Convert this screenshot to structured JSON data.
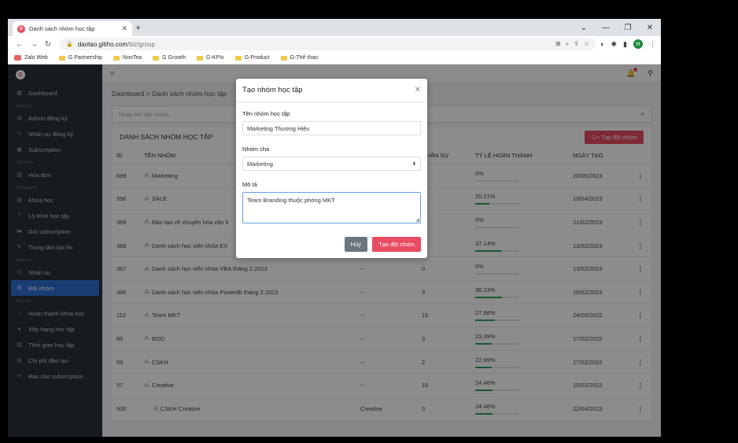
{
  "browser": {
    "tab_title": "Danh sách nhóm học tập",
    "favicon": "G",
    "url_host": "daotao.gitiho.com",
    "url_path": "/biz/group",
    "profile_initial": "H",
    "bookmarks": [
      "Zalo Web",
      "G Partnership",
      "NooTea",
      "G Growth",
      "G-KPIs",
      "G-Product",
      "G-Thể thao"
    ]
  },
  "sidebar": {
    "logo": "G",
    "items": [
      {
        "type": "item",
        "label": "Dashboard",
        "icon": "dashboard-icon",
        "glyph": "▦"
      },
      {
        "type": "group",
        "label": "Đăng ký"
      },
      {
        "type": "item",
        "label": "Admin đăng ký",
        "icon": "register-icon",
        "glyph": "▤"
      },
      {
        "type": "item",
        "label": "Nhân sự đăng ký",
        "icon": "user-register-icon",
        "glyph": "⚇"
      },
      {
        "type": "item",
        "label": "Subscription",
        "icon": "subscription-icon",
        "glyph": "▣"
      },
      {
        "type": "group",
        "label": "Tài chính"
      },
      {
        "type": "item",
        "label": "Hóa đơn",
        "icon": "invoice-icon",
        "glyph": "▥"
      },
      {
        "type": "group",
        "label": "Tài nguyên"
      },
      {
        "type": "item",
        "label": "Khóa học",
        "icon": "course-icon",
        "glyph": "▤"
      },
      {
        "type": "item",
        "label": "Lộ trình học tập",
        "icon": "roadmap-icon",
        "glyph": "⤒"
      },
      {
        "type": "item",
        "label": "Gói subscription",
        "icon": "package-icon",
        "glyph": "⧓"
      },
      {
        "type": "item",
        "label": "Trung tâm bài thi",
        "icon": "exam-icon",
        "glyph": "✎"
      },
      {
        "type": "group",
        "label": "Nhân sự"
      },
      {
        "type": "item",
        "label": "Nhân sự",
        "icon": "staff-icon",
        "glyph": "☷"
      },
      {
        "type": "item",
        "label": "Đội nhóm",
        "icon": "team-icon",
        "glyph": "☰",
        "active": true
      },
      {
        "type": "group",
        "label": "Báo cáo"
      },
      {
        "type": "item",
        "label": "Hoàn thành khóa học",
        "icon": "complete-icon",
        "glyph": "○"
      },
      {
        "type": "item",
        "label": "Xếp hạng học tập",
        "icon": "rank-icon",
        "glyph": "♦"
      },
      {
        "type": "item",
        "label": "Thời gian học tập",
        "icon": "time-icon",
        "glyph": "▥"
      },
      {
        "type": "item",
        "label": "Chi phí đào tạo",
        "icon": "cost-icon",
        "glyph": "◍"
      },
      {
        "type": "item",
        "label": "Báo cáo subscription",
        "icon": "report-icon",
        "glyph": "✂"
      }
    ]
  },
  "main": {
    "breadcrumb": "Dashboard > Danh sách nhóm học tập",
    "search_placeholder": "Nhập tên đội nhóm...",
    "list_title": "DANH SÁCH NHÓM HỌC TẬP",
    "add_button": "Tạo đội nhóm",
    "columns": [
      "ID",
      "TÊN NHÓM",
      "",
      "NHÂN SỰ",
      "TỶ LỆ HOÀN THÀNH",
      "NGÀY TẠO",
      ""
    ],
    "rows": [
      {
        "id": "699",
        "name": "Marketing",
        "parent": "",
        "staff": "",
        "rate": "0%",
        "rate_value": 0,
        "date": "20/05/2023"
      },
      {
        "id": "596",
        "name": "SALE",
        "parent": "",
        "staff": "",
        "rate": "20.21%",
        "rate_value": 20.21,
        "date": "19/04/2023"
      },
      {
        "id": "389",
        "name": "Đào tạo về chuyển hóa văn h",
        "parent": "",
        "staff": "",
        "rate": "0%",
        "rate_value": 0,
        "date": "21/02/2023"
      },
      {
        "id": "388",
        "name": "Danh sách học viên khóa EX",
        "parent": "",
        "staff": "",
        "rate": "37.14%",
        "rate_value": 37.14,
        "date": "13/02/2023"
      },
      {
        "id": "387",
        "name": "Danh sách học viên khóa VBA tháng 2.2023",
        "parent": "--",
        "staff": "0",
        "rate": "0%",
        "rate_value": 0,
        "date": "13/02/2023"
      },
      {
        "id": "386",
        "name": "Danh sách học viên khóa PowerBI tháng 2.2023",
        "parent": "--",
        "staff": "3",
        "rate": "38.23%",
        "rate_value": 38.23,
        "date": "10/02/2023"
      },
      {
        "id": "112",
        "name": "Team MKT",
        "parent": "--",
        "staff": "15",
        "rate": "27.98%",
        "rate_value": 27.98,
        "date": "24/06/2022"
      },
      {
        "id": "60",
        "name": "BOD",
        "parent": "--",
        "staff": "3",
        "rate": "23.39%",
        "rate_value": 23.39,
        "date": "17/02/2022"
      },
      {
        "id": "59",
        "name": "CSKH",
        "parent": "--",
        "staff": "2",
        "rate": "22.99%",
        "rate_value": 22.99,
        "date": "17/02/2022"
      },
      {
        "id": "57",
        "name": "Creative",
        "parent": "--",
        "staff": "16",
        "rate": "24.46%",
        "rate_value": 24.46,
        "date": "15/02/2022"
      },
      {
        "id": "600",
        "name": "CSKH Creative",
        "parent": "Creative",
        "staff": "3",
        "rate": "24.46%",
        "rate_value": 24.46,
        "date": "22/04/2023",
        "child": true
      }
    ]
  },
  "modal": {
    "title": "Tạo nhóm học tập",
    "name_label": "Tên nhóm học tập",
    "name_value": "Marketing Thương Hiệu",
    "parent_label": "Nhóm cha",
    "parent_value": "Marketing",
    "desc_label": "Mô tả",
    "desc_value": "Team Branding thuộc phòng MKT",
    "cancel": "Hủy",
    "submit": "Tạo đội nhóm"
  },
  "colors": {
    "accent": "#e94b63",
    "active": "#2d6fd2",
    "progress": "#2e9e5b",
    "sidebar": "#2b3038"
  }
}
